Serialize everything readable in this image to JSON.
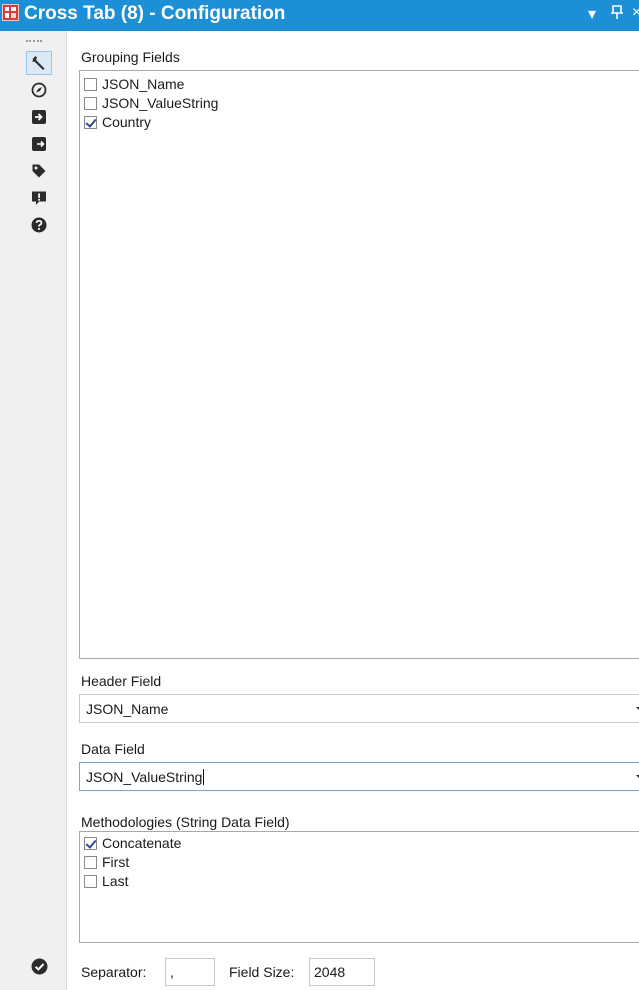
{
  "window": {
    "title": "Cross Tab (8) - Configuration",
    "dropdown_glyph": "▾",
    "pin_glyph": "ꟼ"
  },
  "sidebar": {
    "items": [
      {
        "icon": "wrench-icon",
        "tooltip": "Configuration",
        "active": true
      },
      {
        "icon": "compass-icon",
        "tooltip": "Navigation",
        "active": false
      },
      {
        "icon": "input-arrow-icon",
        "tooltip": "Input",
        "active": false
      },
      {
        "icon": "output-arrow-icon",
        "tooltip": "Output",
        "active": false
      },
      {
        "icon": "tag-icon",
        "tooltip": "Annotation",
        "active": false
      },
      {
        "icon": "alert-icon",
        "tooltip": "Messages",
        "active": false
      },
      {
        "icon": "help-icon",
        "tooltip": "Help",
        "active": false
      }
    ],
    "footer_icon": "check-circle-icon"
  },
  "grouping": {
    "label": "Grouping Fields",
    "items": [
      {
        "label": "JSON_Name",
        "checked": false
      },
      {
        "label": "JSON_ValueString",
        "checked": false
      },
      {
        "label": "Country",
        "checked": true
      }
    ]
  },
  "header_field": {
    "label": "Header Field",
    "value": "JSON_Name"
  },
  "data_field": {
    "label": "Data Field",
    "value": "JSON_ValueString"
  },
  "methodologies": {
    "label": "Methodologies (String Data Field)",
    "items": [
      {
        "label": "Concatenate",
        "checked": true
      },
      {
        "label": "First",
        "checked": false
      },
      {
        "label": "Last",
        "checked": false
      }
    ]
  },
  "separator": {
    "label": "Separator:",
    "value": ","
  },
  "field_size": {
    "label": "Field Size:",
    "value": "2048"
  },
  "colors": {
    "titlebar": "#1c8fd6",
    "icon": "#2b2b2b",
    "check": "#2f4d8a"
  }
}
